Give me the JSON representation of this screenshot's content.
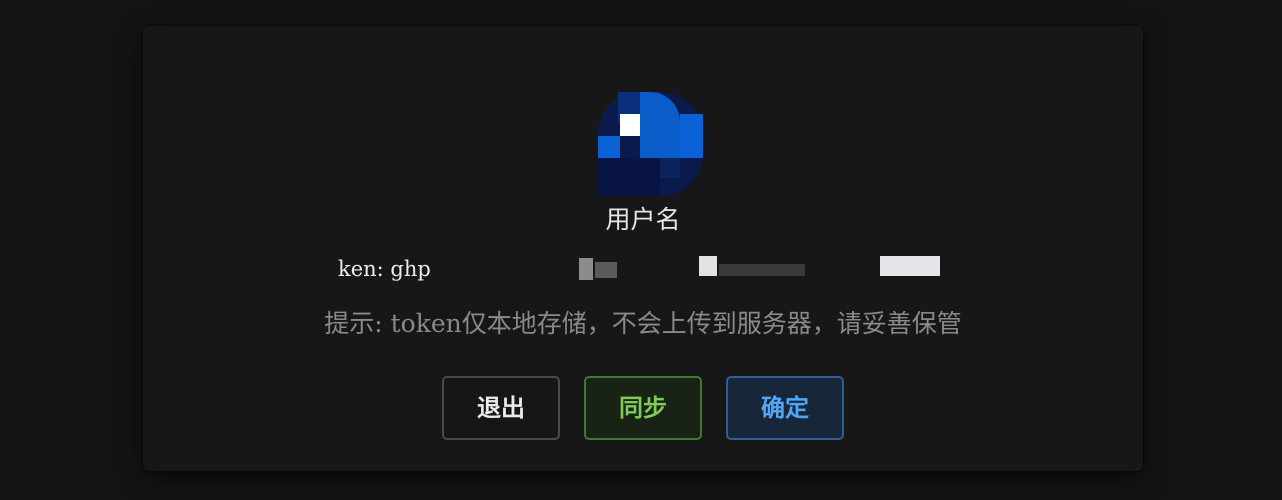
{
  "user": {
    "username": "用户名",
    "avatar_icon": "avatar-pixelated"
  },
  "token": {
    "display_text": "ken: ghp"
  },
  "hint": {
    "text": "提示: token仅本地存储，不会上传到服务器，请妥善保管"
  },
  "buttons": {
    "exit_label": "退出",
    "sync_label": "同步",
    "confirm_label": "确定"
  },
  "colors": {
    "background": "#141414",
    "dialog": "#171717",
    "sync_accent": "#7ecb57",
    "confirm_accent": "#51a7f7"
  }
}
